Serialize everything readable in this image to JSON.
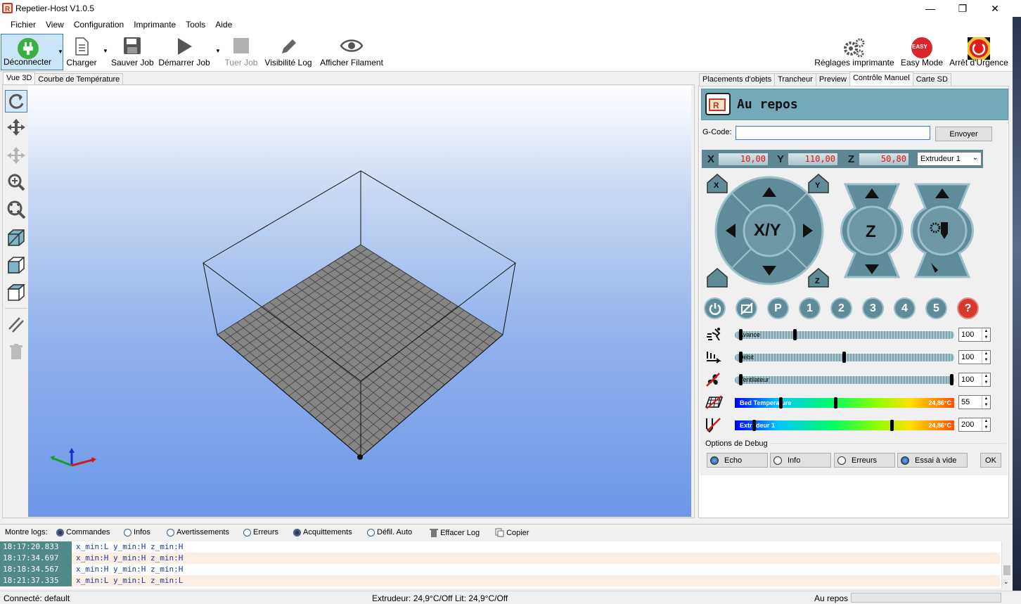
{
  "window": {
    "title": "Repetier-Host V1.0.5"
  },
  "menu": [
    "Fichier",
    "View",
    "Configuration",
    "Imprimante",
    "Tools",
    "Aide"
  ],
  "toolbar": {
    "disconnect": "Déconnecter",
    "load": "Charger",
    "save_job": "Sauver Job",
    "start_job": "Démarrer Job",
    "kill_job": "Tuer Job",
    "log_visibility": "Visibilité Log",
    "show_filament": "Afficher Filament",
    "printer_settings": "Réglages imprimante",
    "easy_mode": "Easy Mode",
    "emergency_stop": "Arrêt d'Urgence",
    "easy_badge": "EASY"
  },
  "left_tabs": [
    "Vue 3D",
    "Courbe de Température"
  ],
  "right_tabs": [
    "Placements d'objets",
    "Trancheur",
    "Preview",
    "Contrôle Manuel",
    "Carte SD"
  ],
  "manual": {
    "status": "Au repos",
    "gcode_label": "G-Code:",
    "gcode_value": "",
    "send": "Envoyer",
    "x_label": "X",
    "x_value": "10,00",
    "y_label": "Y",
    "y_value": "110,00",
    "z_label": "Z",
    "z_value": "50,80",
    "extruder_select": "Extrudeur 1",
    "xy_label": "X/Y",
    "z_btn": "Z",
    "home_x": "X",
    "home_y": "Y",
    "home_z": "Z",
    "func_buttons": [
      "P",
      "1",
      "2",
      "3",
      "4",
      "5",
      "?"
    ],
    "feed": {
      "label": "Avance",
      "value": "100",
      "fraction": 0.27
    },
    "flow": {
      "label": "Débit",
      "value": "100",
      "fraction": 0.5
    },
    "fan": {
      "label": "Ventilateur",
      "value": "100",
      "fraction": 1.0
    },
    "bed": {
      "label": "Bed Temperature",
      "reading": "24,86°C",
      "target": "55"
    },
    "extruder": {
      "label": "Extrudeur 1",
      "reading": "24,86°C",
      "target": "200"
    },
    "debug_title": "Options de Debug",
    "debug": [
      "Echo",
      "Info",
      "Erreurs",
      "Essai à vide"
    ],
    "ok": "OK"
  },
  "log": {
    "label": "Montre logs:",
    "options": [
      "Commandes",
      "Infos",
      "Avertissements",
      "Erreurs",
      "Acquittements",
      "Défil. Auto"
    ],
    "clear": "Effacer Log",
    "copy": "Copier",
    "rows": [
      {
        "ts": "18:17:20.833",
        "msg": "x_min:L y_min:H z_min:H"
      },
      {
        "ts": "18:17:34.697",
        "msg": "x_min:H y_min:H z_min:H"
      },
      {
        "ts": "18:18:34.567",
        "msg": "x_min:H y_min:H z_min:H"
      },
      {
        "ts": "18:21:37.335",
        "msg": "x_min:L y_min:L z_min:L"
      }
    ]
  },
  "status": {
    "connected": "Connecté: default",
    "temps": "Extrudeur: 24,9°C/Off Lit: 24,9°C/Off",
    "state": "Au repos"
  }
}
